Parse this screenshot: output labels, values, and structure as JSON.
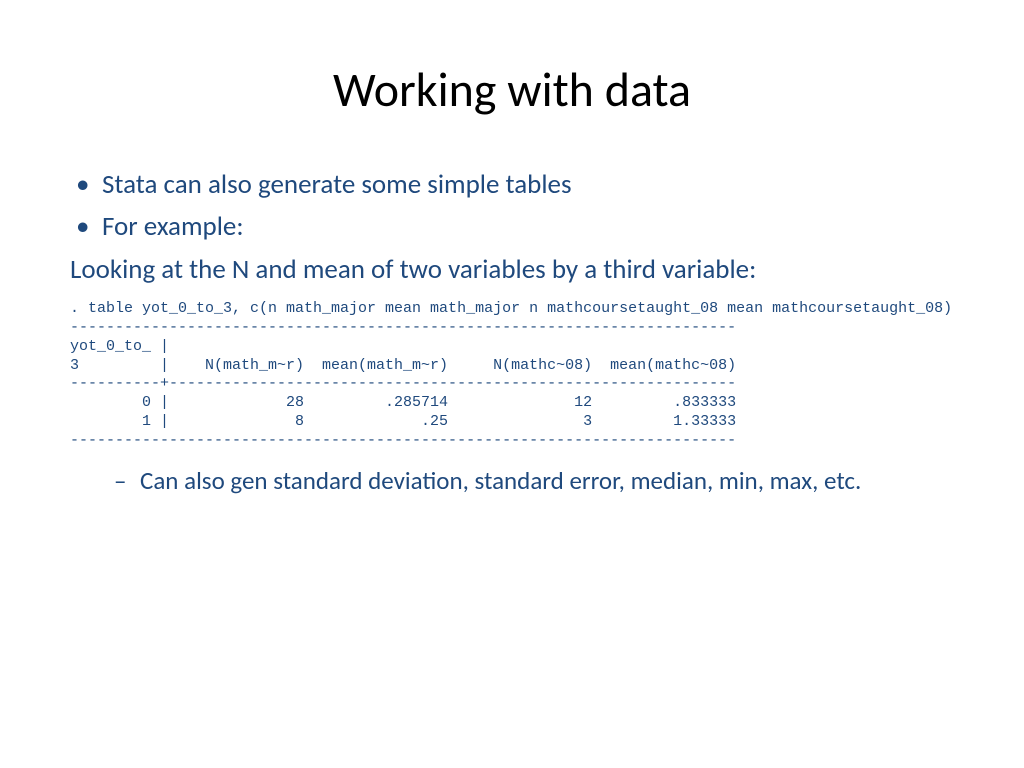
{
  "title": "Working with data",
  "bullets": {
    "b1": "Stata can also generate some simple tables",
    "b2": "For example:"
  },
  "para1": "Looking at the N and mean of two variables by a third variable:",
  "code": ". table yot_0_to_3, c(n math_major mean math_major n mathcoursetaught_08 mean mathcoursetaught_08)\n--------------------------------------------------------------------------\nyot_0_to_ |\n3         |    N(math_m~r)  mean(math_m~r)     N(mathc~08)  mean(mathc~08)\n----------+---------------------------------------------------------------\n        0 |             28         .285714              12         .833333\n        1 |              8             .25               3         1.33333\n--------------------------------------------------------------------------",
  "sub": {
    "s1": "Can also gen standard deviation, standard error, median, min, max, etc."
  }
}
